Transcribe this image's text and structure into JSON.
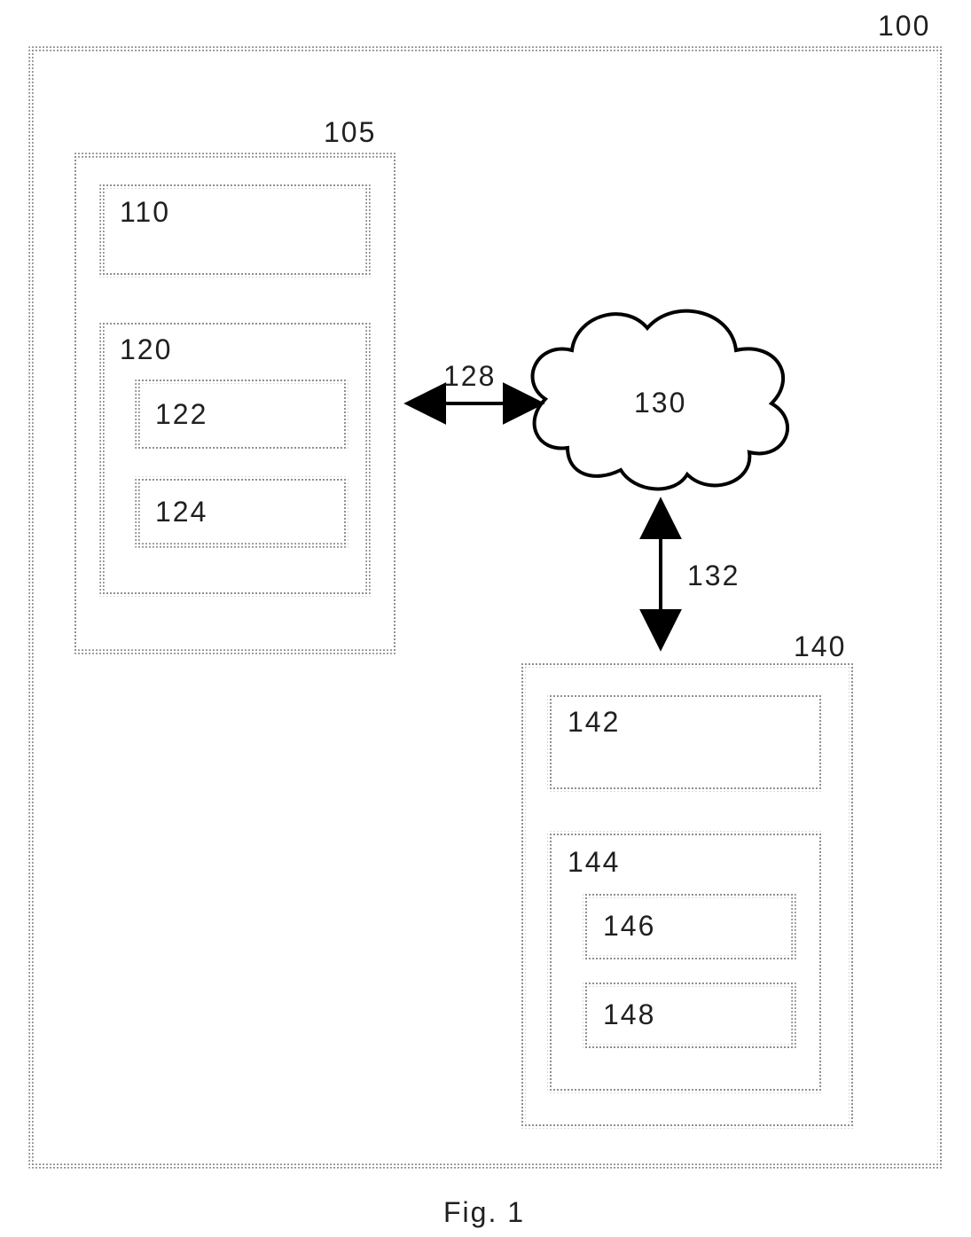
{
  "figure_label": "Fig. 1",
  "outer_frame": "100",
  "block_a": {
    "label": "105",
    "item1": "110",
    "group": {
      "label": "120",
      "sub1": "122",
      "sub2": "124"
    }
  },
  "link_a_to_cloud": "128",
  "cloud": "130",
  "link_cloud_to_b": "132",
  "block_b": {
    "label": "140",
    "item1": "142",
    "group": {
      "label": "144",
      "sub1": "146",
      "sub2": "148"
    }
  }
}
